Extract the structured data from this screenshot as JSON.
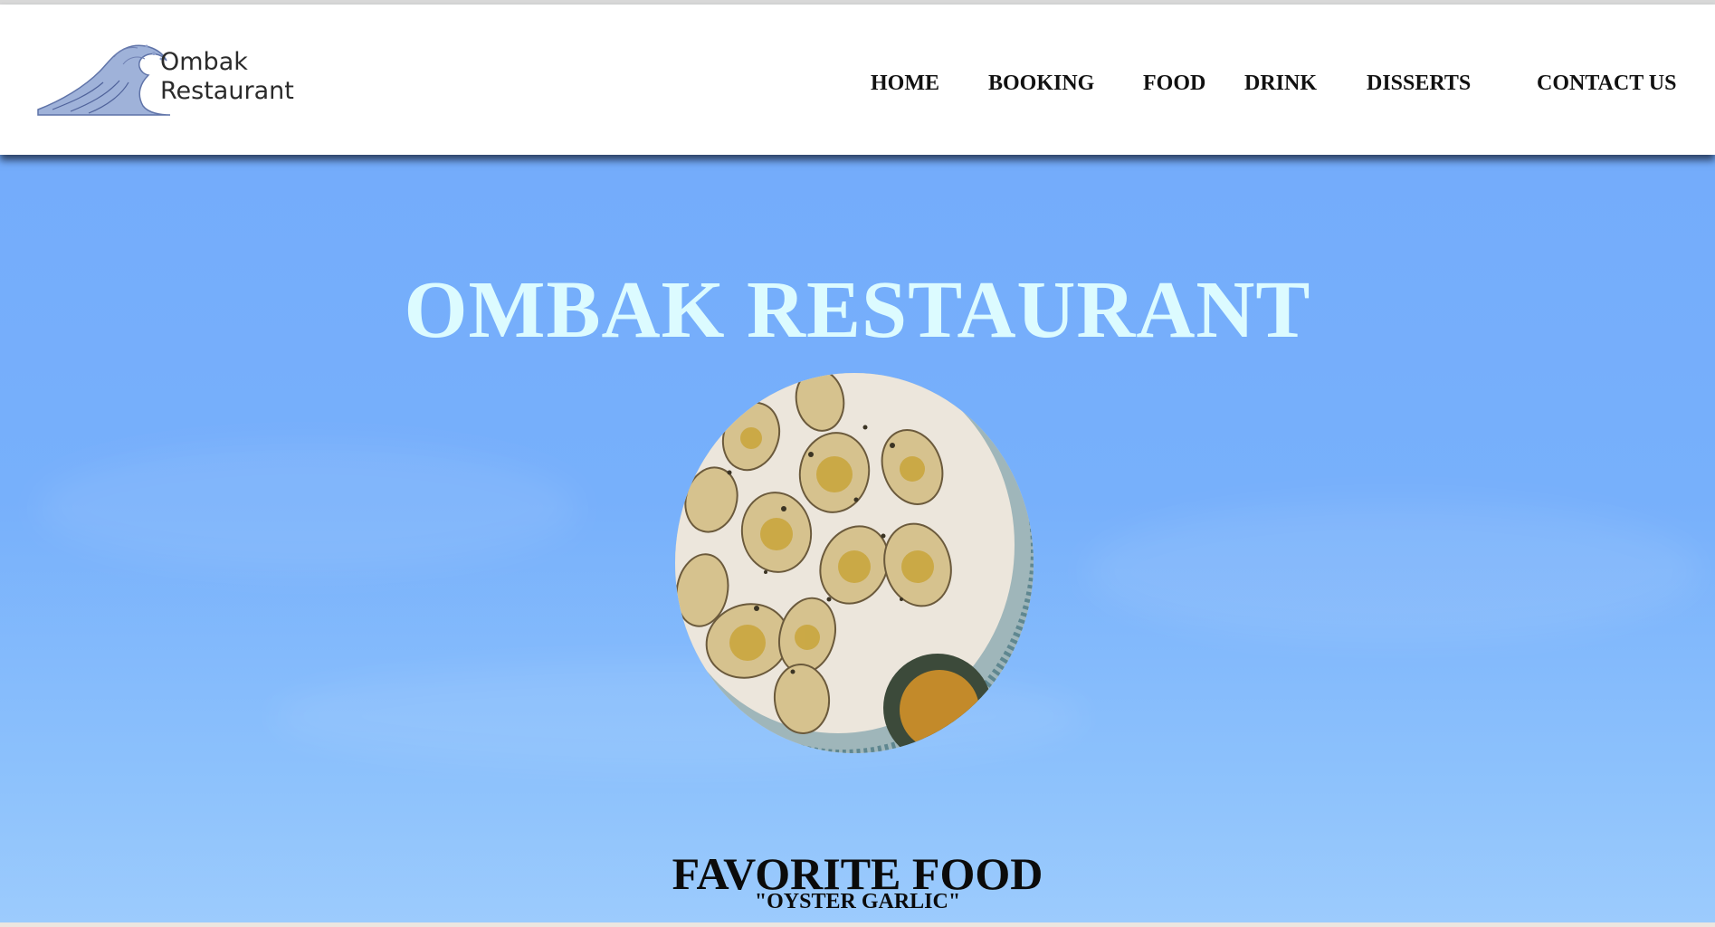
{
  "brand": {
    "line1": "Ombak",
    "line2": "Restaurant",
    "logo_icon": "wave-icon"
  },
  "nav": {
    "items": [
      {
        "label": "HOME"
      },
      {
        "label": "BOOKING"
      },
      {
        "label": "FOOD"
      },
      {
        "label": "DRINK"
      },
      {
        "label": "DISSERTS"
      },
      {
        "label": "CONTACT US"
      }
    ]
  },
  "hero": {
    "title": "OMBAK RESTAURANT"
  },
  "featured": {
    "heading": "FAVORITE FOOD",
    "dish": "\"OYSTER GARLIC\"",
    "photo": "oyster-plate-photo"
  },
  "colors": {
    "sky_top": "#74acfb",
    "sky_bottom": "#9ccbfd",
    "title_text": "#dcfbff",
    "nav_text": "#111111"
  }
}
